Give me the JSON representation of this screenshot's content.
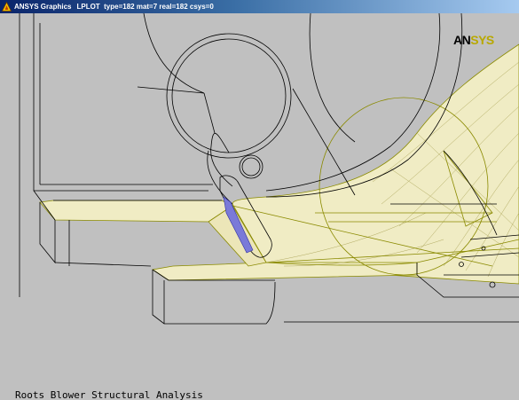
{
  "window": {
    "app_name": "ANSYS Graphics",
    "status_line": "LPLOT  type=182 mat=7 real=182 csys=0"
  },
  "logo": {
    "prefix": "AN",
    "suffix": "SYS"
  },
  "caption": "Roots Blower Structural Analysis",
  "colors": {
    "background": "#c0c0c0",
    "wireframe": "#000000",
    "area_fill": "#f0ecc4",
    "area_edges": "#8a8a00",
    "highlight_area": "#7a7ad8",
    "title_gradient_start": "#0a246a",
    "title_gradient_end": "#a6caf0"
  },
  "icons": {
    "app": "ansys-triangle-icon"
  }
}
